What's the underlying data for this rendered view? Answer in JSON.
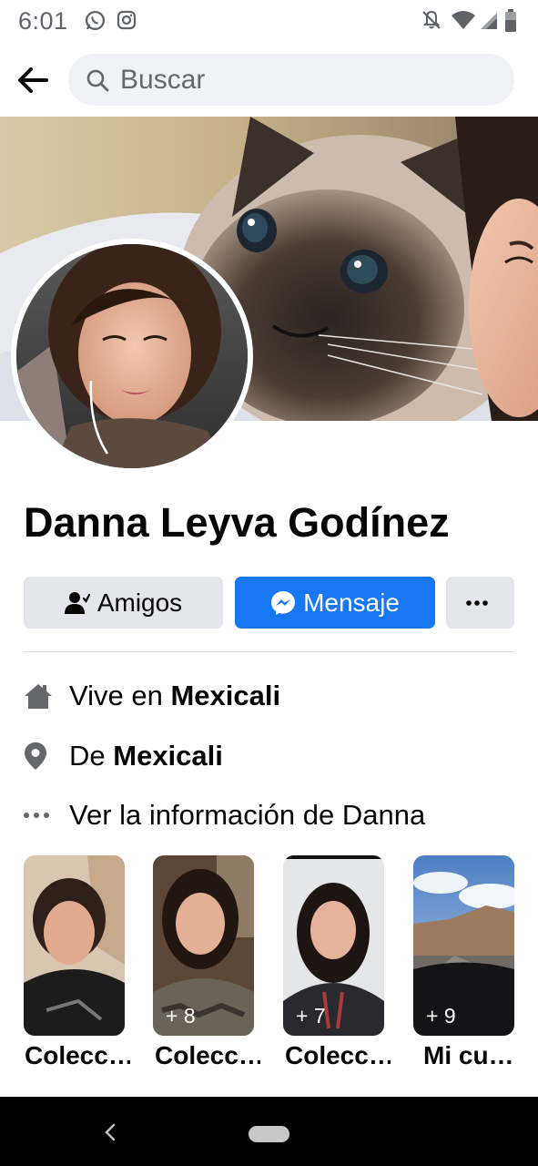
{
  "status_bar": {
    "time": "6:01"
  },
  "search": {
    "placeholder": "Buscar"
  },
  "profile": {
    "name": "Danna Leyva Godínez"
  },
  "actions": {
    "friends_label": "Amigos",
    "message_label": "Mensaje"
  },
  "info": {
    "lives_prefix": "Vive en ",
    "lives_city": "Mexicali",
    "from_prefix": "De ",
    "from_city": "Mexicali",
    "see_more": "Ver la información de Danna"
  },
  "highlights": [
    {
      "label": "Colecc…",
      "count": ""
    },
    {
      "label": "Colecc…",
      "count": "+ 8"
    },
    {
      "label": "Colecc…",
      "count": "+ 7"
    },
    {
      "label": "Mi cu…",
      "count": "+ 9"
    }
  ],
  "colors": {
    "accent": "#1877f2",
    "button_gray": "#e4e6eb",
    "search_bg": "#f0f2f5"
  },
  "icons": [
    "whatsapp-icon",
    "instagram-icon",
    "mute-icon",
    "wifi-icon",
    "signal-icon",
    "battery-icon",
    "back-arrow-icon",
    "search-icon",
    "add-friend-icon",
    "messenger-icon",
    "more-icon",
    "home-icon",
    "location-icon",
    "ellipsis-icon"
  ]
}
